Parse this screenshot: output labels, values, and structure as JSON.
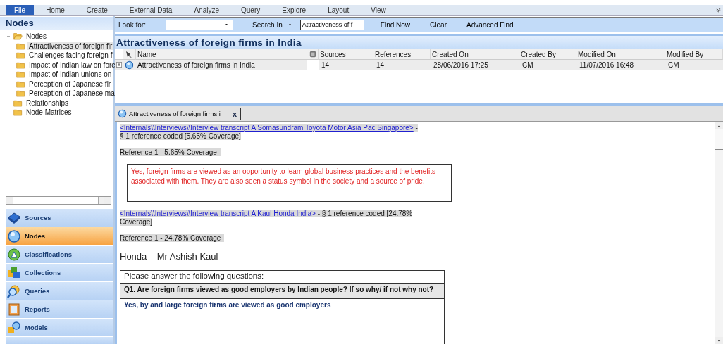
{
  "ribbon": {
    "tabs": [
      {
        "label": "File",
        "selected": true
      },
      {
        "label": "Home",
        "selected": false
      },
      {
        "label": "Create",
        "selected": false
      },
      {
        "label": "External Data",
        "selected": false
      },
      {
        "label": "Analyze",
        "selected": false
      },
      {
        "label": "Query",
        "selected": false
      },
      {
        "label": "Explore",
        "selected": false
      },
      {
        "label": "Layout",
        "selected": false
      },
      {
        "label": "View",
        "selected": false
      }
    ]
  },
  "sidebar": {
    "title": "Nodes",
    "tree": [
      {
        "label": "Nodes",
        "expanded": true,
        "selected": false,
        "children": [
          {
            "label": "Attractiveness of foreign fir",
            "selected": true
          },
          {
            "label": "Challenges facing foreign fi",
            "selected": false
          },
          {
            "label": "Impact of Indian law on fore",
            "selected": false
          },
          {
            "label": "Impact of Indian unions on",
            "selected": false
          },
          {
            "label": "Perception of Japanese fir",
            "selected": false
          },
          {
            "label": "Perception of Japanese ma",
            "selected": false
          }
        ]
      },
      {
        "label": "Relationships",
        "selected": false
      },
      {
        "label": "Node Matrices",
        "selected": false
      }
    ],
    "navigation": [
      {
        "label": "Sources",
        "selected": false
      },
      {
        "label": "Nodes",
        "selected": true
      },
      {
        "label": "Classifications",
        "selected": false
      },
      {
        "label": "Collections",
        "selected": false
      },
      {
        "label": "Queries",
        "selected": false
      },
      {
        "label": "Reports",
        "selected": false
      },
      {
        "label": "Models",
        "selected": false
      }
    ]
  },
  "find_bar": {
    "look_for_label": "Look for:",
    "search_in_label": "Search In",
    "search_in_value": "Attractiveness of f",
    "buttons": [
      "Find Now",
      "Clear",
      "Advanced Find"
    ]
  },
  "list_view": {
    "title": "Attractiveness of foreign firms in India",
    "columns": [
      "Name",
      "Sources",
      "References",
      "Created On",
      "Created By",
      "Modified On",
      "Modified By"
    ],
    "rows": [
      {
        "name": "Attractiveness of foreign firms in India",
        "sources": "14",
        "references": "14",
        "created_on": "28/06/2016 17:25",
        "created_by": "CM",
        "modified_on": "11/07/2016 16:48",
        "modified_by": "CM",
        "selected": true
      }
    ]
  },
  "detail_tab": {
    "label": "Attractiveness of foreign firms i",
    "close": "x"
  },
  "document": [
    {
      "kind": "source",
      "link": "<Internals\\\\Interviews\\\\Interview transcript  A Somasundram Toyota Motor Asia Pac Singapore>",
      "text": " - § 1 reference coded  [5.65% Coverage]"
    },
    {
      "kind": "reference",
      "text": "Reference 1 - 5.65% Coverage"
    },
    {
      "kind": "quote",
      "text": "Yes, foreign firms are viewed as an opportunity to learn global business practices and the benefits associated with them. They are also seen a status symbol in the society and a source of pride."
    },
    {
      "kind": "source",
      "link": "<Internals\\\\Interviews\\\\Interview transcript A Kaul Honda India>",
      "text": " - § 1 reference coded  [24.78% Coverage]"
    },
    {
      "kind": "reference",
      "text": "Reference 1 - 24.78% Coverage"
    },
    {
      "kind": "heading",
      "text": "Honda – Mr Ashish Kaul"
    },
    {
      "kind": "table",
      "rows": [
        {
          "kind": "plain",
          "text": "Please answer the following questions:"
        },
        {
          "kind": "question",
          "text": "Q1. Are foreign firms viewed as good employers by Indian people? If so why/ if not why not?"
        },
        {
          "kind": "answer",
          "text": "Yes, by and large foreign firms are viewed as good employers"
        }
      ]
    }
  ]
}
